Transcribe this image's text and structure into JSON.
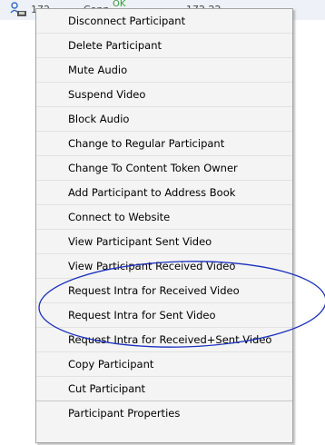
{
  "background_row": {
    "col1": "172",
    "col2": "Conn",
    "ok_label": "OK",
    "col3": "172.22"
  },
  "context_menu": {
    "items": [
      {
        "label": "Disconnect Participant"
      },
      {
        "label": "Delete Participant"
      },
      {
        "label": "Mute Audio"
      },
      {
        "label": "Suspend Video"
      },
      {
        "label": "Block Audio"
      },
      {
        "label": "Change to Regular Participant"
      },
      {
        "label": "Change To Content Token Owner"
      },
      {
        "label": "Add Participant to Address Book"
      },
      {
        "label": "Connect to Website"
      },
      {
        "label": "View Participant Sent Video"
      },
      {
        "label": "View Participant Received Video"
      },
      {
        "label": "Request Intra for Received Video"
      },
      {
        "label": "Request Intra for Sent Video"
      },
      {
        "label": "Request Intra for Received+Sent Video"
      },
      {
        "label": "Copy Participant"
      },
      {
        "label": "Cut Participant"
      },
      {
        "label": "Participant Properties"
      }
    ]
  },
  "annotation_color": "#1a2fbf"
}
